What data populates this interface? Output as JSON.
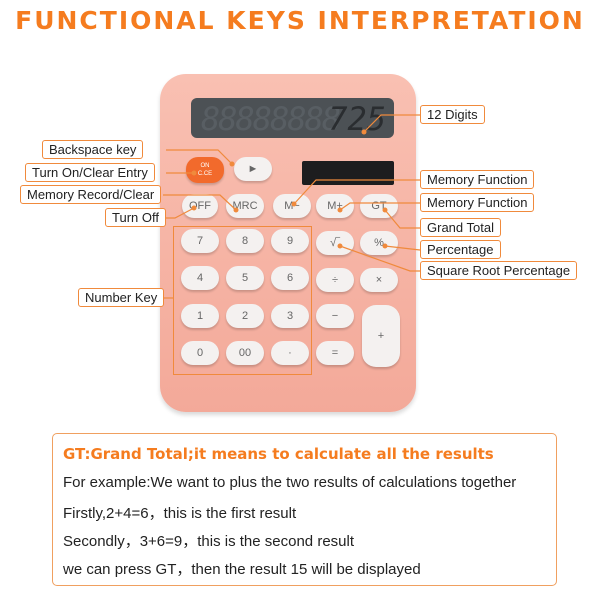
{
  "title": "FUNCTIONAL KEYS INTERPRETATION",
  "display": {
    "value": "725",
    "ghost": "88888888"
  },
  "keys": {
    "on_top": "ON",
    "on_bottom": "C.CE",
    "backspace": "►",
    "off": "OFF",
    "mrc": "MRC",
    "m_minus": "M−",
    "m_plus": "M+",
    "gt": "GT",
    "n7": "7",
    "n8": "8",
    "n9": "9",
    "n4": "4",
    "n5": "5",
    "n6": "6",
    "n1": "1",
    "n2": "2",
    "n3": "3",
    "n0": "0",
    "n00": "00",
    "dot": "·",
    "sqrt": "√‾",
    "percent": "%",
    "divide": "÷",
    "multiply": "×",
    "minus": "−",
    "equals": "=",
    "plus": "+"
  },
  "labels": {
    "backspace": "Backspace key",
    "turn_on": "Turn On/Clear Entry",
    "memory_record": "Memory Record/Clear",
    "turn_off": "Turn Off",
    "number_key": "Number Key",
    "digits": "12 Digits",
    "memory_function_1": "Memory Function",
    "memory_function_2": "Memory Function",
    "grand_total": "Grand Total",
    "percentage": "Percentage",
    "sqrt_percentage": "Square Root Percentage"
  },
  "info": {
    "heading": "GT:Grand Total;it means to calculate all the results",
    "lines": [
      "For example:We want to plus the two  results of calculations together",
      "Firstly,2+4=6，this is the first result",
      "Secondly，3+6=9，this is the second result",
      "we can press GT，then the result 15 will be displayed"
    ]
  },
  "colors": {
    "accent": "#f57c1f",
    "body": "#f6b3a4",
    "on_key": "#f26a2c"
  }
}
